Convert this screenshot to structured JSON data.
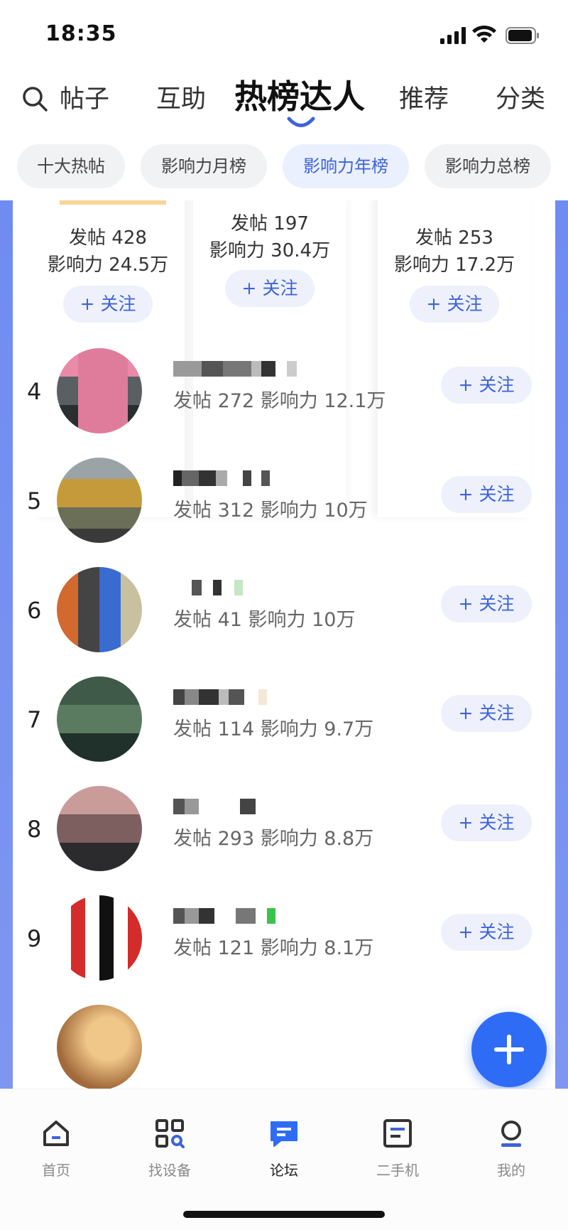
{
  "status_bar": {
    "time": "18:35"
  },
  "search": {
    "label": "帖子"
  },
  "tabs": [
    {
      "label": "互助"
    },
    {
      "label": "热榜达人"
    },
    {
      "label": "推荐"
    },
    {
      "label": "分类"
    }
  ],
  "chips": [
    {
      "label": "十大热帖"
    },
    {
      "label": "影响力月榜"
    },
    {
      "label": "影响力年榜"
    },
    {
      "label": "影响力总榜"
    }
  ],
  "podium": [
    {
      "posts": "发帖 428",
      "influence": "影响力 24.5万",
      "follow": "+ 关注"
    },
    {
      "posts": "发帖 197",
      "influence": "影响力 30.4万",
      "follow": "+ 关注"
    },
    {
      "posts": "发帖 253",
      "influence": "影响力 17.2万",
      "follow": "+ 关注"
    }
  ],
  "ranking": [
    {
      "rank": "4",
      "stats": "发帖 272  影响力 12.1万",
      "follow": "+ 关注"
    },
    {
      "rank": "5",
      "stats": "发帖 312  影响力 10万",
      "follow": "+ 关注"
    },
    {
      "rank": "6",
      "stats": "发帖 41  影响力 10万",
      "follow": "+ 关注"
    },
    {
      "rank": "7",
      "stats": "发帖 114  影响力 9.7万",
      "follow": "+ 关注"
    },
    {
      "rank": "8",
      "stats": "发帖 293  影响力 8.8万",
      "follow": "+ 关注"
    },
    {
      "rank": "9",
      "stats": "发帖 121  影响力 8.1万",
      "follow": "+ 关注"
    }
  ],
  "bottom_nav": [
    {
      "label": "首页",
      "icon": "home-icon"
    },
    {
      "label": "找设备",
      "icon": "find-device-icon"
    },
    {
      "label": "论坛",
      "icon": "forum-icon"
    },
    {
      "label": "二手机",
      "icon": "second-hand-icon"
    },
    {
      "label": "我的",
      "icon": "profile-icon"
    }
  ],
  "colors": {
    "accent": "#3d63d9",
    "fab": "#2f6cf6",
    "panel_border": "#7e96f2",
    "chip_active_bg": "#eaf0fd"
  }
}
